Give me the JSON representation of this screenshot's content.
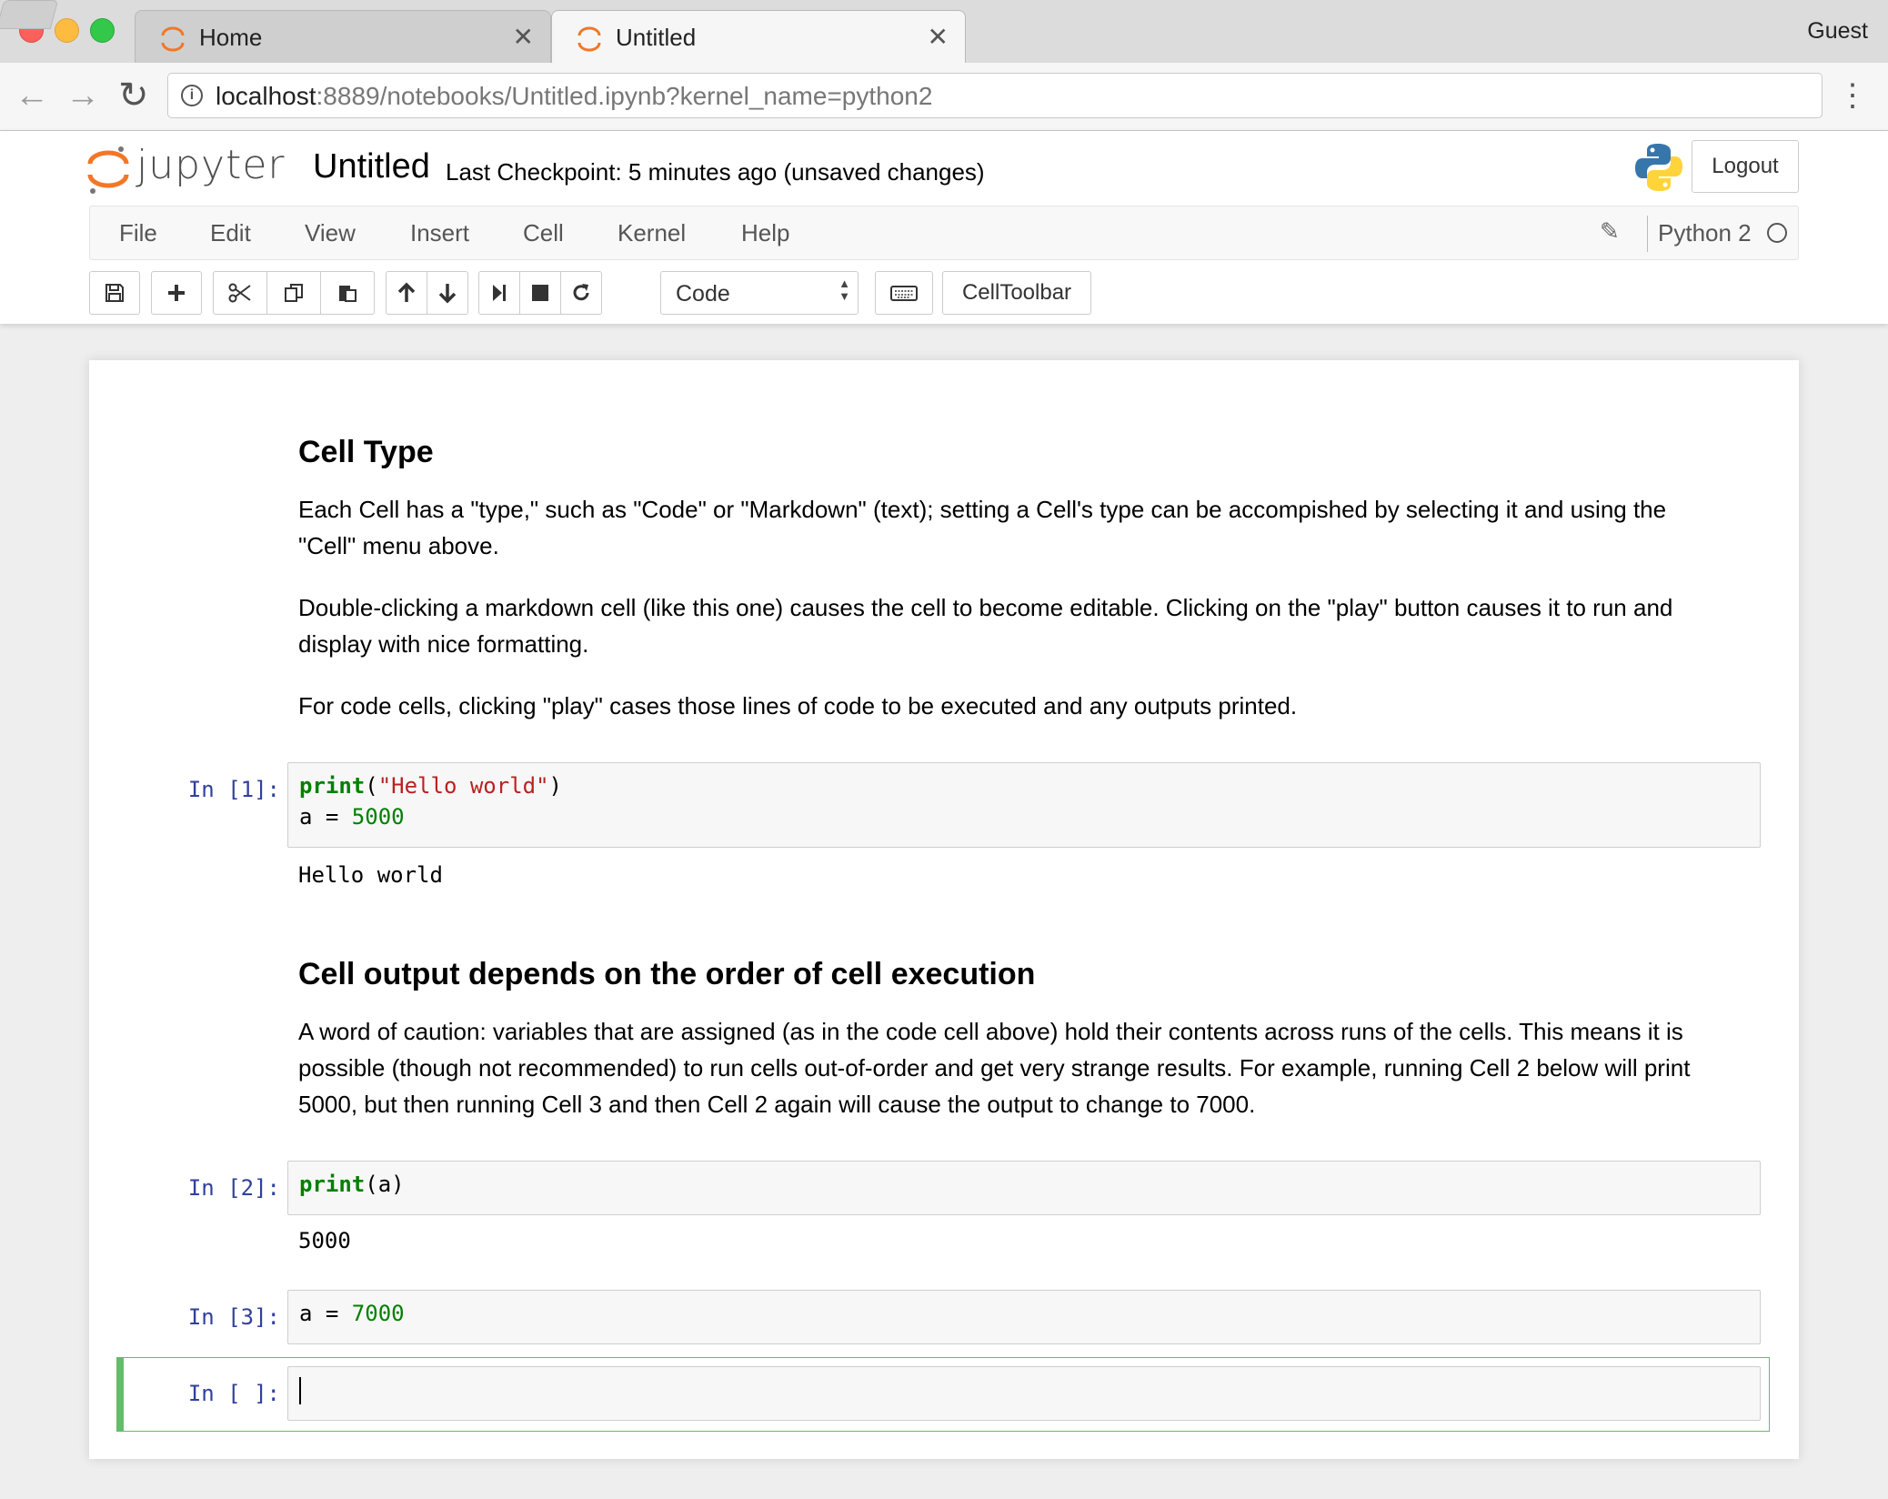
{
  "browser": {
    "tabs": [
      {
        "label": "Home"
      },
      {
        "label": "Untitled"
      }
    ],
    "profile": "Guest",
    "url_host": "localhost",
    "url_rest": ":8889/notebooks/Untitled.ipynb?kernel_name=python2"
  },
  "header": {
    "logo_text": "jupyter",
    "notebook_name": "Untitled",
    "checkpoint": "Last Checkpoint: 5 minutes ago (unsaved changes)",
    "logout": "Logout"
  },
  "menubar": {
    "items": [
      "File",
      "Edit",
      "View",
      "Insert",
      "Cell",
      "Kernel",
      "Help"
    ],
    "kernel": "Python 2"
  },
  "toolbar": {
    "cell_type": "Code",
    "celltoolbar": "CellToolbar"
  },
  "cells": {
    "md1": {
      "heading": "Cell Type",
      "p1": "Each Cell has a \"type,\" such as \"Code\" or \"Markdown\" (text); setting a Cell's type can be accompished by selecting it and using the \"Cell\" menu above.",
      "p2": "Double-clicking a markdown cell (like this one) causes the cell to become editable. Clicking on the \"play\" button causes it to run and display with nice formatting.",
      "p3": "For code cells, clicking \"play\" cases those lines of code to be executed and any outputs printed."
    },
    "code1": {
      "prompt": "In [1]:",
      "line1_kw": "print",
      "line1_open": "(",
      "line1_str": "\"Hello world\"",
      "line1_close": ")",
      "line2_var": "a = ",
      "line2_num": "5000",
      "output": "Hello world"
    },
    "md2": {
      "heading": "Cell output depends on the order of cell execution",
      "p1": "A word of caution: variables that are assigned (as in the code cell above) hold their contents across runs of the cells. This means it is possible (though not recommended) to run cells out-of-order and get very strange results. For example, running Cell 2 below will print 5000, but then running Cell 3 and then Cell 2 again will cause the output to change to 7000."
    },
    "code2": {
      "prompt": "In [2]:",
      "kw": "print",
      "rest": "(a)",
      "output": "5000"
    },
    "code3": {
      "prompt": "In [3]:",
      "var": "a = ",
      "num": "7000"
    },
    "code4": {
      "prompt": "In [ ]:"
    }
  },
  "colors": {
    "jupyter_orange": "#f37726",
    "prompt_blue": "#303f9f",
    "keyword_green": "#008000",
    "string_red": "#ba2121",
    "selected_border": "#66bb6a"
  }
}
